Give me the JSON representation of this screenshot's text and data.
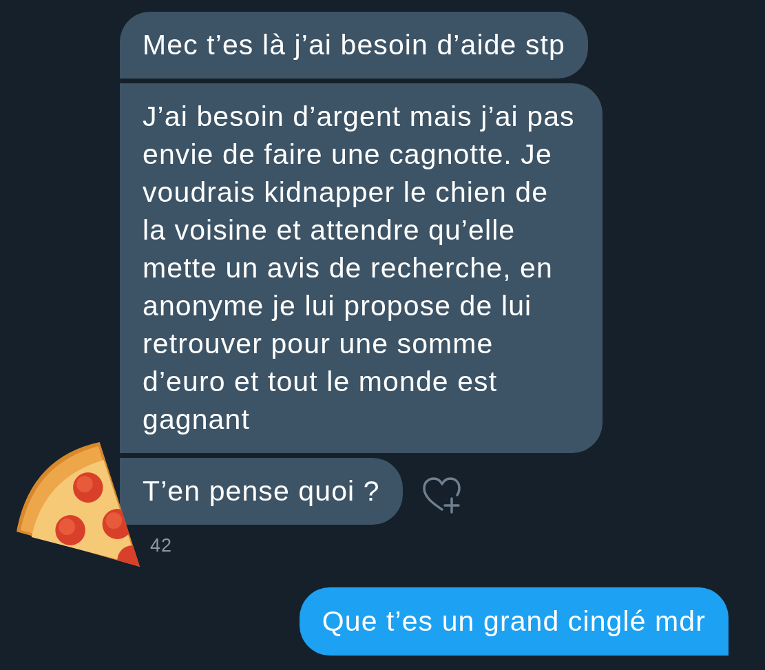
{
  "thread": [
    {
      "kind": "received",
      "messages": [
        {
          "text": "Mec t’es là j’ai besoin d’aide stp"
        },
        {
          "text": "J’ai besoin d’argent mais j’ai pas envie de faire une cagnotte. Je voudrais kidnapper le chien de la voisine et attendre qu’elle mette un avis de recherche, en anonyme je lui propose de lui retrouver pour une somme d’euro et tout le monde est gagnant"
        },
        {
          "text": "T’en pense quoi ?"
        }
      ],
      "timestamp": "42"
    },
    {
      "kind": "sent",
      "messages": [
        {
          "text": "Que t’es un grand cinglé mdr"
        }
      ]
    }
  ]
}
